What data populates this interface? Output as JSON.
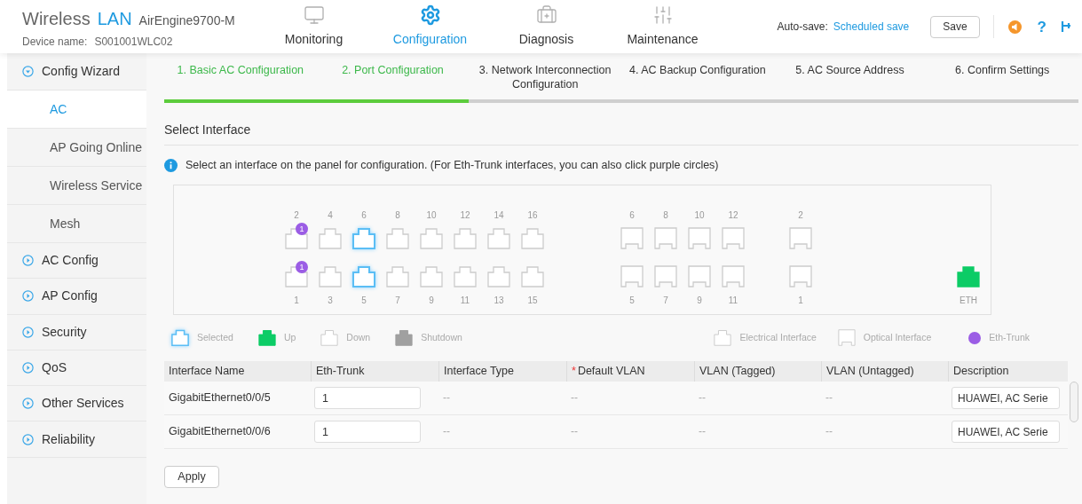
{
  "header": {
    "brand": "Wireless",
    "brand_accent": "LAN",
    "model": "AirEngine9700-M",
    "device_label": "Device name:",
    "device_name": "S001001WLC02",
    "nav": [
      {
        "label": "Monitoring",
        "kind": "monitor",
        "selected": false
      },
      {
        "label": "Configuration",
        "kind": "gear",
        "selected": true
      },
      {
        "label": "Diagnosis",
        "kind": "kit",
        "selected": false
      },
      {
        "label": "Maintenance",
        "kind": "sliders",
        "selected": false
      }
    ],
    "autosave_label": "Auto-save:",
    "autosave_link": "Scheduled save",
    "save": "Save",
    "help": "?"
  },
  "sidebar": [
    {
      "label": "Config Wizard",
      "expanded": true,
      "children": [
        {
          "label": "AC",
          "selected": true
        },
        {
          "label": "AP Going Online",
          "selected": false
        },
        {
          "label": "Wireless Service",
          "selected": false
        },
        {
          "label": "Mesh",
          "selected": false
        }
      ]
    },
    {
      "label": "AC Config",
      "expanded": false
    },
    {
      "label": "AP Config",
      "expanded": false
    },
    {
      "label": "Security",
      "expanded": false
    },
    {
      "label": "QoS",
      "expanded": false
    },
    {
      "label": "Other Services",
      "expanded": false
    },
    {
      "label": "Reliability",
      "expanded": false
    }
  ],
  "steps": [
    {
      "label": "1. Basic AC Configuration",
      "done": true
    },
    {
      "label": "2. Port Configuration",
      "done": true
    },
    {
      "label": "3. Network Interconnection Configuration",
      "done": false
    },
    {
      "label": "4. AC Backup Configuration",
      "done": false
    },
    {
      "label": "5. AC Source Address",
      "done": false
    },
    {
      "label": "6. Confirm Settings",
      "done": false
    }
  ],
  "progress": {
    "level": 0.333
  },
  "section_title": "Select Interface",
  "info": "Select an interface on the panel for configuration. (For Eth-Trunk interfaces, you can also click purple circles)",
  "panel": {
    "groups": [
      {
        "kind": "electrical",
        "columns": [
          {
            "top": {
              "label": "2",
              "up": false,
              "selected": false,
              "trunk": "1"
            },
            "bottom": {
              "label": "1",
              "up": false,
              "selected": false,
              "trunk": "1"
            }
          },
          {
            "top": {
              "label": "4",
              "up": false,
              "selected": false
            },
            "bottom": {
              "label": "3",
              "up": false,
              "selected": false
            }
          },
          {
            "top": {
              "label": "6",
              "up": false,
              "selected": true
            },
            "bottom": {
              "label": "5",
              "up": false,
              "selected": true
            }
          },
          {
            "top": {
              "label": "8",
              "up": false,
              "selected": false
            },
            "bottom": {
              "label": "7",
              "up": false,
              "selected": false
            }
          },
          {
            "top": {
              "label": "10",
              "up": false,
              "selected": false
            },
            "bottom": {
              "label": "9",
              "up": false,
              "selected": false
            }
          },
          {
            "top": {
              "label": "12",
              "up": false,
              "selected": false
            },
            "bottom": {
              "label": "11",
              "up": false,
              "selected": false
            }
          },
          {
            "top": {
              "label": "14",
              "up": false,
              "selected": false
            },
            "bottom": {
              "label": "13",
              "up": false,
              "selected": false
            }
          },
          {
            "top": {
              "label": "16",
              "up": false,
              "selected": false
            },
            "bottom": {
              "label": "15",
              "up": false,
              "selected": false
            }
          }
        ]
      },
      {
        "kind": "optical",
        "columns": [
          {
            "top": {
              "label": "6",
              "up": false,
              "selected": false
            },
            "bottom": {
              "label": "5",
              "up": false,
              "selected": false
            }
          },
          {
            "top": {
              "label": "8",
              "up": false,
              "selected": false
            },
            "bottom": {
              "label": "7",
              "up": false,
              "selected": false
            }
          },
          {
            "top": {
              "label": "10",
              "up": false,
              "selected": false
            },
            "bottom": {
              "label": "9",
              "up": false,
              "selected": false
            }
          },
          {
            "top": {
              "label": "12",
              "up": false,
              "selected": false
            },
            "bottom": {
              "label": "11",
              "up": false,
              "selected": false
            }
          }
        ]
      },
      {
        "kind": "optical",
        "columns": [
          {
            "top": {
              "label": "2",
              "up": false,
              "selected": false
            },
            "bottom": {
              "label": "1",
              "up": false,
              "selected": false
            }
          }
        ]
      },
      {
        "kind": "electrical",
        "columns": [
          {
            "bottom": {
              "label": "ETH",
              "up": true,
              "selected": false
            }
          }
        ]
      }
    ]
  },
  "legend": [
    {
      "kind": "selected",
      "label": "Selected"
    },
    {
      "kind": "up",
      "label": "Up"
    },
    {
      "kind": "down",
      "label": "Down"
    },
    {
      "kind": "shutdown",
      "label": "Shutdown"
    },
    {
      "kind": "electrical",
      "label": "Electrical Interface"
    },
    {
      "kind": "optical",
      "label": "Optical Interface"
    },
    {
      "kind": "trunk",
      "label": "Eth-Trunk"
    }
  ],
  "table": {
    "columns": [
      {
        "label": "Interface Name"
      },
      {
        "label": "Eth-Trunk"
      },
      {
        "label": "Interface Type"
      },
      {
        "label": "Default VLAN",
        "required_mark": "*"
      },
      {
        "label": "VLAN (Tagged)"
      },
      {
        "label": "VLAN (Untagged)"
      },
      {
        "label": "Description"
      }
    ],
    "rows": [
      {
        "name": "GigabitEthernet0/0/5",
        "eth_trunk": "1",
        "type": "--",
        "default_vlan": "--",
        "tagged": "--",
        "untagged": "--",
        "description": "HUAWEI, AC Serie"
      },
      {
        "name": "GigabitEthernet0/0/6",
        "eth_trunk": "1",
        "type": "--",
        "default_vlan": "--",
        "tagged": "--",
        "untagged": "--",
        "description": "HUAWEI, AC Serie"
      }
    ]
  },
  "apply": "Apply"
}
